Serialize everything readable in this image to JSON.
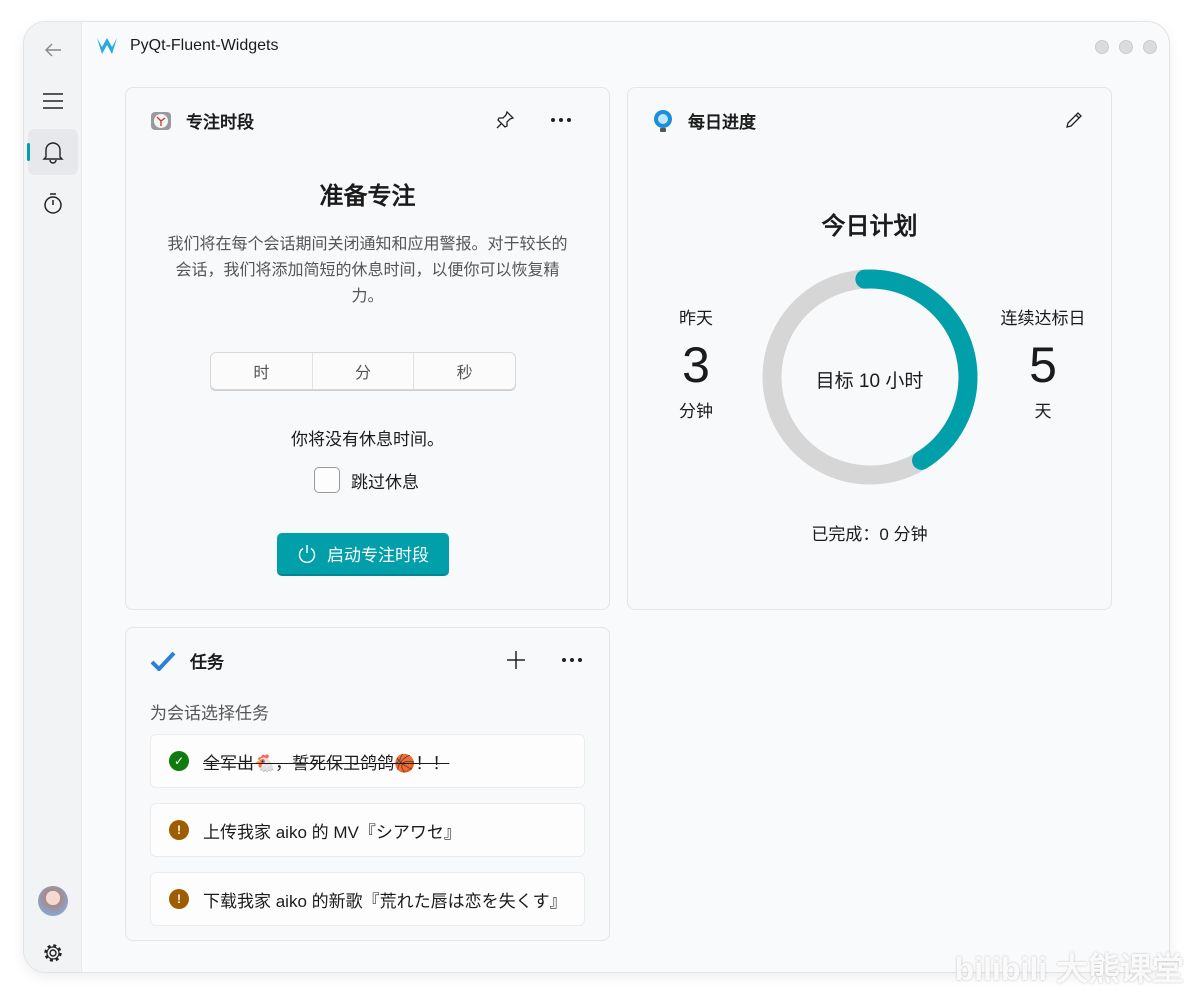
{
  "app": {
    "title": "PyQt-Fluent-Widgets"
  },
  "sidebar": {
    "items": [
      {
        "icon": "back-icon"
      },
      {
        "icon": "menu-icon"
      },
      {
        "icon": "bell-icon",
        "active": true
      },
      {
        "icon": "stopwatch-icon"
      },
      {
        "icon": "avatar"
      },
      {
        "icon": "gear-icon"
      }
    ]
  },
  "focus": {
    "title": "专注时段",
    "heading": "准备专注",
    "description": "我们将在每个会话期间关闭通知和应用警报。对于较长的会话，我们将添加简短的休息时间，以便你可以恢复精力。",
    "time_units": [
      "时",
      "分",
      "秒"
    ],
    "break_text": "你将没有休息时间。",
    "skip_break_label": "跳过休息",
    "skip_break_checked": false,
    "start_button": "启动专注时段"
  },
  "progress": {
    "title": "每日进度",
    "heading": "今日计划",
    "yesterday_label": "昨天",
    "yesterday_value": "3",
    "yesterday_unit": "分钟",
    "streak_label": "连续达标日",
    "streak_value": "5",
    "streak_unit": "天",
    "goal_text": "目标 10 小时",
    "completed_text": "已完成：0 分钟",
    "ring_fraction": 0.42,
    "accent": "#009faa"
  },
  "tasks": {
    "title": "任务",
    "subtitle": "为会话选择任务",
    "items": [
      {
        "text": "全军出🐔，誓死保卫鸽鸽🏀！！",
        "status": "done",
        "color": "#0f7b0f"
      },
      {
        "text": "上传我家 aiko 的 MV『シアワセ』",
        "status": "pending",
        "color": "#9d5d00"
      },
      {
        "text": "下载我家 aiko 的新歌『荒れた唇は恋を失くす』",
        "status": "pending",
        "color": "#9d5d00"
      }
    ]
  },
  "watermark": "bilibili 大熊课堂"
}
